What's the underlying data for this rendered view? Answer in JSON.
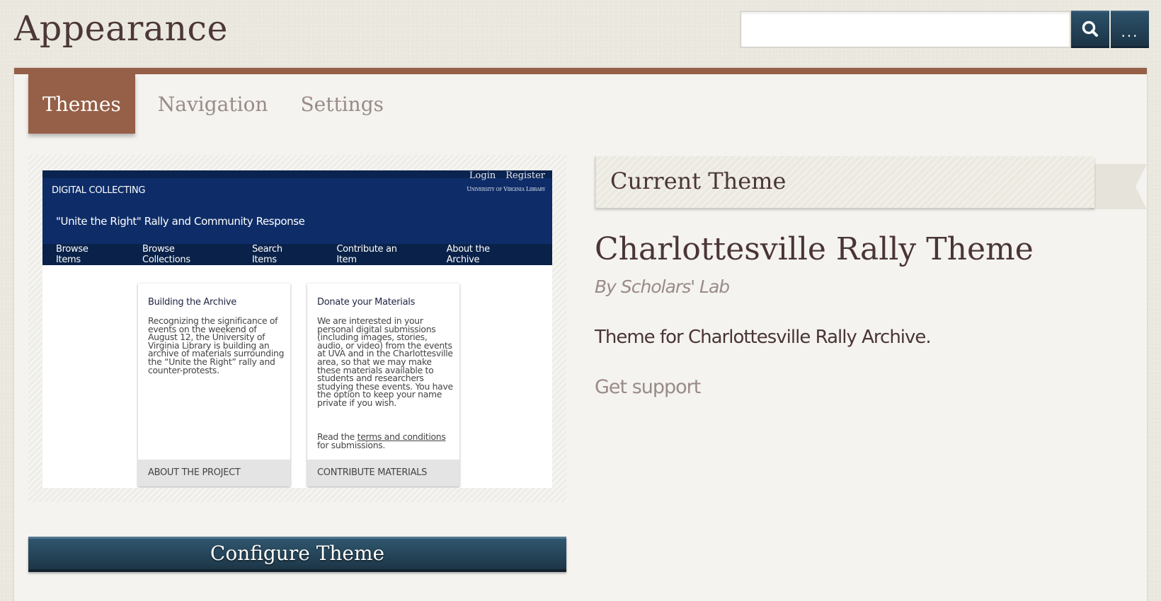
{
  "page": {
    "title": "Appearance"
  },
  "search": {
    "value": "",
    "placeholder": "",
    "search_icon": "search-icon",
    "more_label": "..."
  },
  "colors": {
    "accent": "#965f47",
    "button": "#24435a",
    "muted": "#9a8b88",
    "text": "#4a3535"
  },
  "tabs": [
    {
      "label": "Themes",
      "active": true
    },
    {
      "label": "Navigation",
      "active": false
    },
    {
      "label": "Settings",
      "active": false
    }
  ],
  "preview": {
    "login": "Login",
    "register": "Register",
    "brand": "DIGITAL COLLECTING",
    "library": "University of Virginia Library",
    "site_title": "\"Unite the Right\" Rally and Community Response",
    "nav": [
      "Browse Items",
      "Browse Collections",
      "Search Items",
      "Contribute an Item",
      "About the Archive"
    ],
    "cards": [
      {
        "title": "Building the Archive",
        "body": "Recognizing the significance of events on the weekend of August 12, the University of Virginia Library is building an archive of materials surrounding the “Unite the Right” rally and counter-protests.",
        "footer": "ABOUT THE PROJECT"
      },
      {
        "title": "Donate your Materials",
        "body": "We are interested in your personal digital submissions (including images, stories, audio, or video) from the events at UVA and in the Charlottesville area, so that we may make these materials available to students and researchers studying these events. You have the option to keep your name private if you wish.",
        "note_prefix": "Read the ",
        "note_link": "terms and conditions",
        "note_suffix": " for submissions.",
        "footer": "CONTRIBUTE MATERIALS"
      }
    ]
  },
  "configure_button": "Configure Theme",
  "current_theme": {
    "heading": "Current Theme",
    "name": "Charlottesville Rally Theme",
    "author": "By Scholars' Lab",
    "description": "Theme for Charlottesville Rally Archive.",
    "support_link": "Get support"
  }
}
